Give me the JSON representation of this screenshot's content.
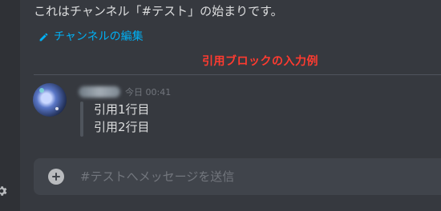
{
  "channel": {
    "start_text": "これはチャンネル「#テスト」の始まりです。",
    "edit_link": "チャンネルの編集"
  },
  "annotation": "引用ブロックの入力例",
  "message": {
    "timestamp": "今日 00:41",
    "quote_lines": [
      "引用1行目",
      "引用2行目"
    ]
  },
  "composer": {
    "placeholder": "#テストへメッセージを送信"
  },
  "icons": {
    "settings": "gear-icon",
    "edit": "pencil-icon",
    "add": "plus-circle-icon"
  },
  "colors": {
    "background": "#36393f",
    "link": "#00b0f4",
    "annotation": "#ff3b30",
    "composer": "#40444b"
  }
}
